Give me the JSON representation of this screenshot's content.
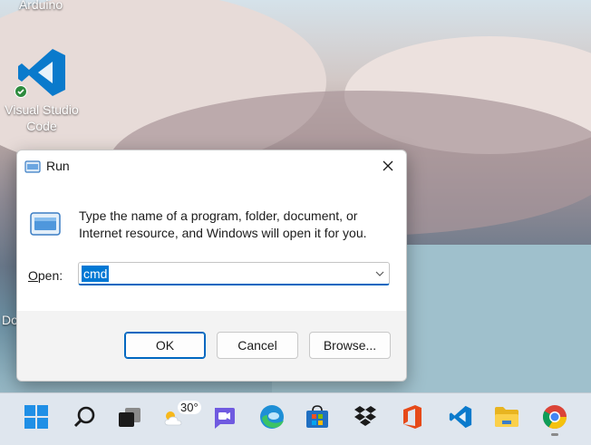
{
  "desktop": {
    "icons": [
      {
        "label": "Arduino"
      },
      {
        "label": "Visual Studio Code"
      },
      {
        "label": "Do"
      }
    ]
  },
  "run_dialog": {
    "title": "Run",
    "description": "Type the name of a program, folder, document, or Internet resource, and Windows will open it for you.",
    "open_label": "Open:",
    "open_label_access_key": "O",
    "open_label_rest": "pen:",
    "input_value": "cmd",
    "buttons": {
      "ok": "OK",
      "cancel": "Cancel",
      "browse": "Browse..."
    }
  },
  "taskbar": {
    "weather_temp": "30°",
    "items": [
      "start-icon",
      "search-icon",
      "task-view-icon",
      "weather-icon",
      "teams-chat-icon",
      "edge-icon",
      "store-icon",
      "dropbox-icon",
      "office-icon",
      "vscode-icon",
      "file-explorer-icon",
      "chrome-icon"
    ]
  },
  "colors": {
    "accent": "#0067c0",
    "vscode_blue": "#0a7acc",
    "selection": "#0078d4"
  }
}
